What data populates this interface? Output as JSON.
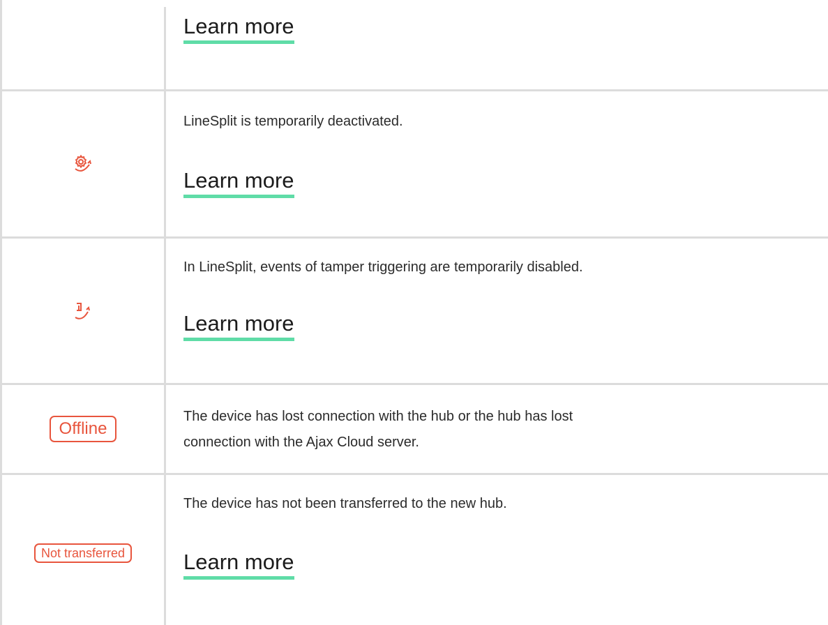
{
  "rows": [
    {
      "learn_more": "Learn more"
    },
    {
      "icon": "linesplit-deactivated-icon",
      "description": "LineSplit is temporarily deactivated.",
      "learn_more": "Learn more"
    },
    {
      "icon": "linesplit-tamper-disabled-icon",
      "description": "In LineSplit, events of tamper triggering are temporarily disabled.",
      "learn_more": "Learn more"
    },
    {
      "badge": "Offline",
      "description_line1": "The device has lost connection with the hub or the hub has lost",
      "description_line2": "connection with the Ajax Cloud server."
    },
    {
      "badge": "Not transferred",
      "description": "The device has not been transferred to the new hub.",
      "learn_more": "Learn more"
    }
  ],
  "colors": {
    "accent_underline": "#5fdca7",
    "status_red": "#e8553d",
    "grid_line": "#dcdcdc"
  }
}
